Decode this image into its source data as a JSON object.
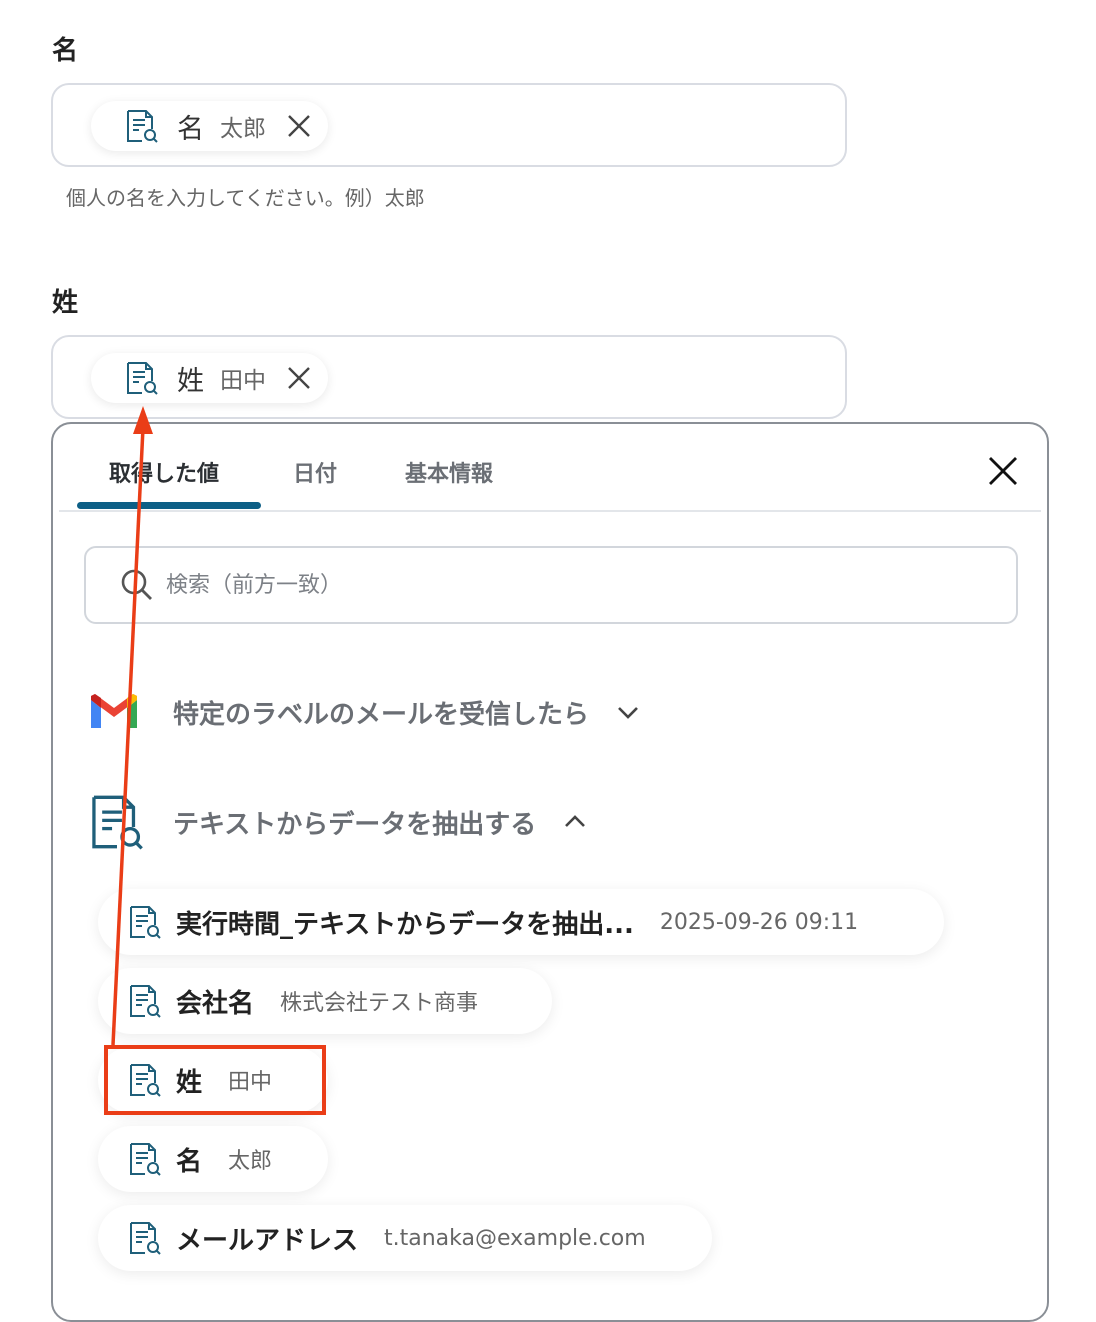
{
  "first_name_field": {
    "label": "名",
    "chip": {
      "key": "名",
      "value": "太郎"
    },
    "hint": "個人の名を入力してください。例）太郎"
  },
  "last_name_field": {
    "label": "姓",
    "chip": {
      "key": "姓",
      "value": "田中"
    }
  },
  "panel": {
    "tabs": [
      {
        "label": "取得した値",
        "active": true
      },
      {
        "label": "日付",
        "active": false
      },
      {
        "label": "基本情報",
        "active": false
      }
    ],
    "search": {
      "placeholder": "検索（前方一致）"
    },
    "sections": [
      {
        "title": "特定のラベルのメールを受信したら",
        "icon": "gmail-icon",
        "expanded": false
      },
      {
        "title": "テキストからデータを抽出する",
        "icon": "document-search-icon",
        "expanded": true
      }
    ],
    "items": [
      {
        "key": "実行時間_テキストからデータを抽出...",
        "value": "2025-09-26 09:11"
      },
      {
        "key": "会社名",
        "value": "株式会社テスト商事"
      },
      {
        "key": "姓",
        "value": "田中"
      },
      {
        "key": "名",
        "value": "太郎"
      },
      {
        "key": "メールアドレス",
        "value": "t.tanaka@example.com"
      }
    ]
  },
  "colors": {
    "accent": "#0d5f86",
    "annotation": "#ea3d17",
    "icon_stroke": "#1f5f7a"
  }
}
